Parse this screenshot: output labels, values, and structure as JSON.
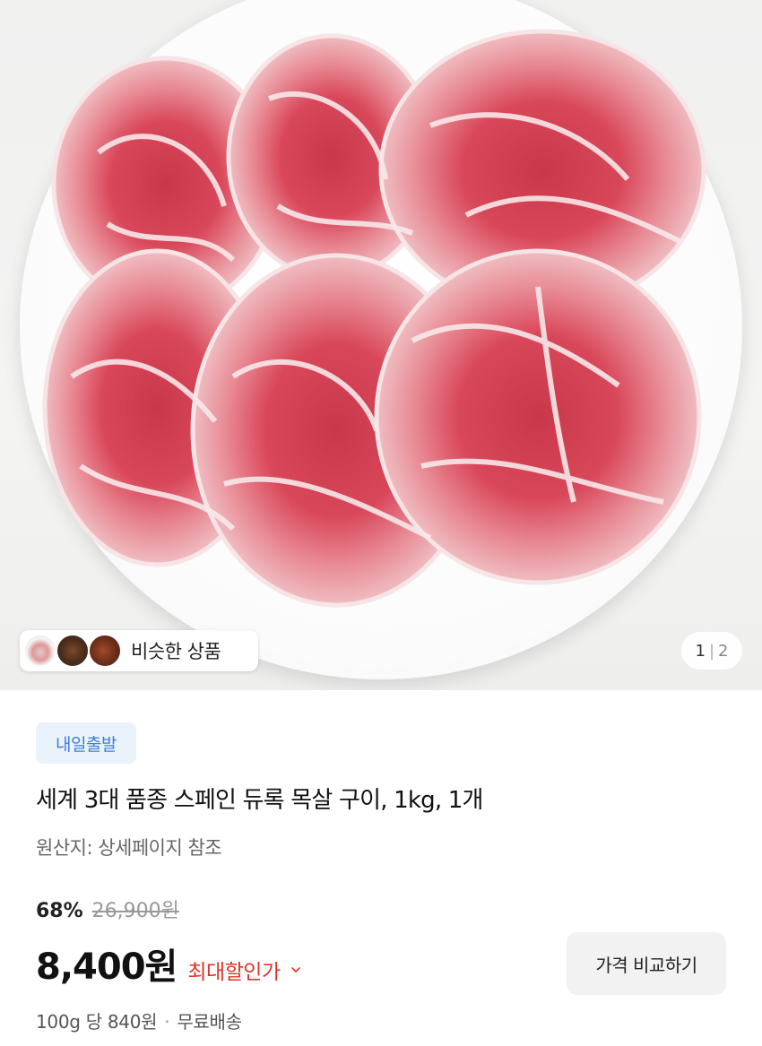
{
  "hero": {
    "image_alt": "sliced pork neck on white plate",
    "similar_label": "비슷한 상품",
    "pager": {
      "current": "1",
      "total": "2"
    }
  },
  "product": {
    "badge": "내일출발",
    "title": "세계 3대 품종 스페인 듀록 목살 구이, 1kg, 1개",
    "origin": "원산지: 상세페이지 참조",
    "discount_percent": "68%",
    "original_price": "26,900원",
    "price": "8,400원",
    "max_discount_label": "최대할인가",
    "compare_button": "가격 비교하기",
    "unit_price": "100g 당 840원",
    "shipping": "무료배송"
  },
  "colors": {
    "badge_bg": "#eaf2fc",
    "badge_text": "#3f7fd6",
    "discount_red": "#e0342a"
  }
}
